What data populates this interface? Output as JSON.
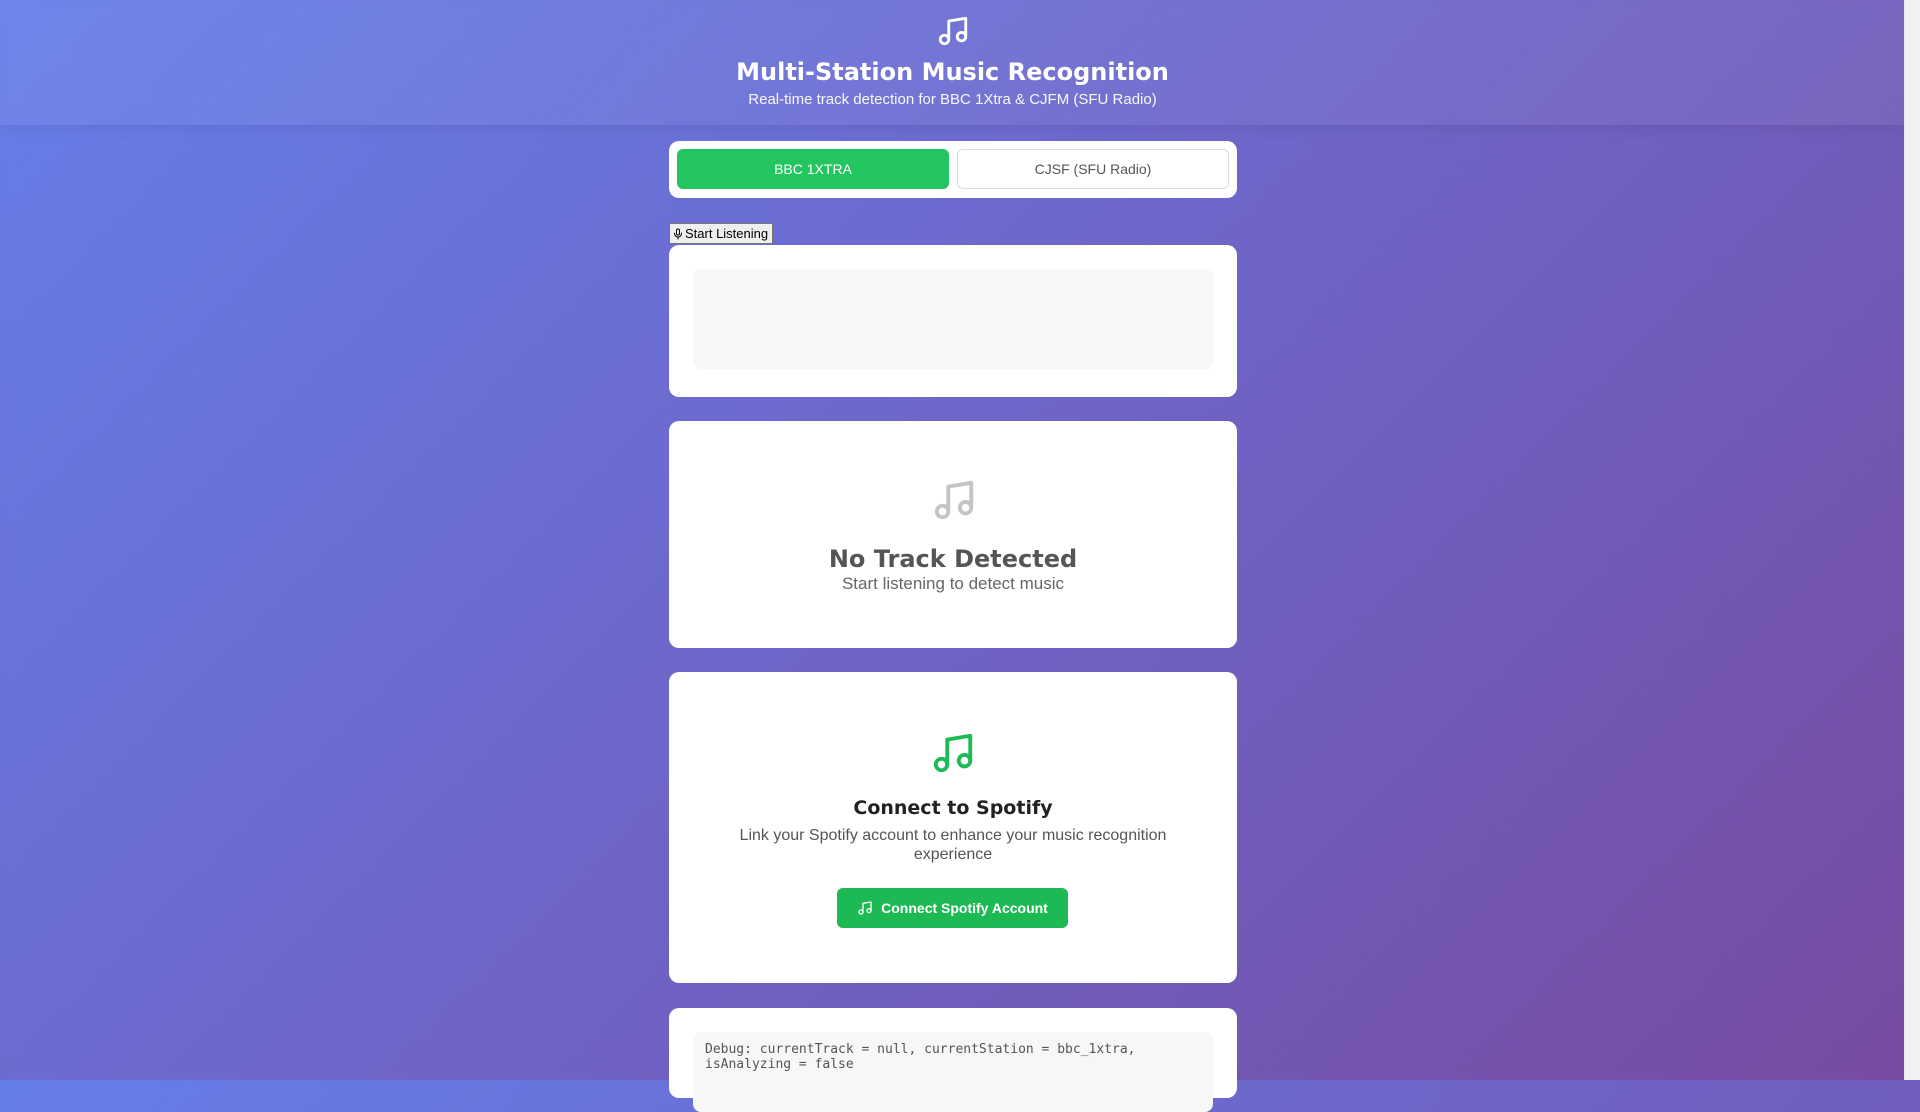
{
  "header": {
    "title": "Multi-Station Music Recognition",
    "subtitle": "Real-time track detection for BBC 1Xtra & CJFM (SFU Radio)",
    "icon": "music-note-icon"
  },
  "stations": [
    {
      "label": "BBC 1XTRA",
      "active": true
    },
    {
      "label": "CJSF (SFU Radio)",
      "active": false
    }
  ],
  "listen": {
    "label": "Start Listening",
    "icon": "microphone-icon"
  },
  "track": {
    "title": "No Track Detected",
    "message": "Start listening to detect music",
    "icon": "music-note-icon"
  },
  "spotify": {
    "title": "Connect to Spotify",
    "description": "Link your Spotify account to enhance your music recognition experience",
    "button_label": "Connect Spotify Account",
    "icon": "music-note-icon"
  },
  "debug": {
    "text": "Debug: currentTrack = null, currentStation = bbc_1xtra, isAnalyzing = false"
  },
  "colors": {
    "accent_green": "#22c55e",
    "spotify_green": "#1db954",
    "gradient_start": "#667eea",
    "gradient_end": "#764ba2"
  }
}
